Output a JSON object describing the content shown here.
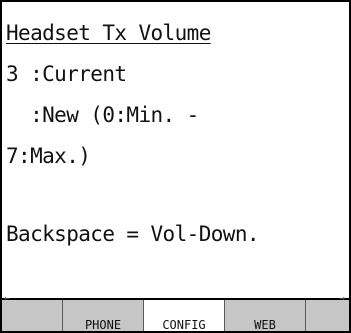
{
  "screen": {
    "title": "Headset Tx Volume",
    "lines": [
      "3 :Current",
      "  :New (0:Min. -",
      "7:Max.)",
      "Backspace = Vol-Down."
    ]
  },
  "softkeys": {
    "tabs": [
      "PHONE",
      "CONFIG",
      "WEB"
    ],
    "selected": "CONFIG"
  },
  "colors": {
    "background": "#ffffff",
    "tabbar": "#c6c6c6",
    "selected_tab": "#ffffff",
    "text": "#111111"
  }
}
